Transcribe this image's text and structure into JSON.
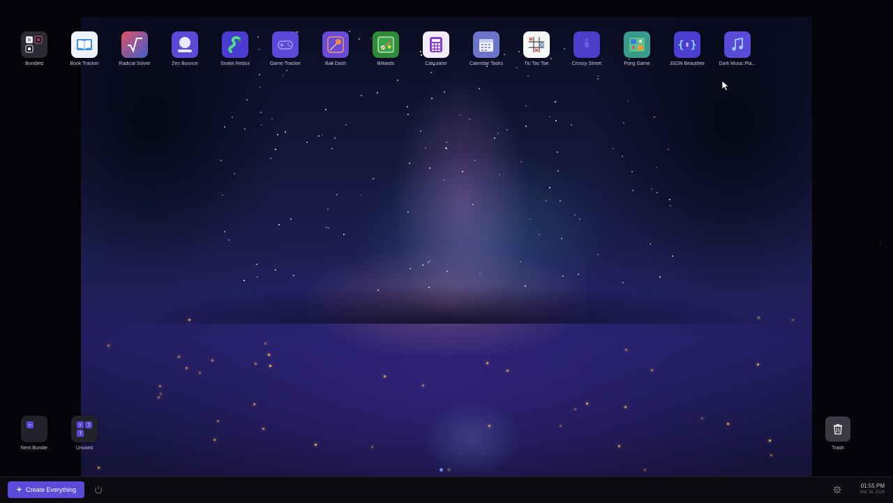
{
  "desktop": {
    "apps": [
      {
        "label": "Bundled",
        "icon": "bundle-folder-icon",
        "bg": "#2a2a34"
      },
      {
        "label": "Book Tracker",
        "icon": "book-icon",
        "bg": "#eef3fb"
      },
      {
        "label": "Radical Solver",
        "icon": "square-root-icon",
        "bg": "#d94a6a"
      },
      {
        "label": "Zen Bounce",
        "icon": "zen-ball-icon",
        "bg": "#5b4ad6"
      },
      {
        "label": "Snake Redux",
        "icon": "snake-icon",
        "bg": "#4a3bd1"
      },
      {
        "label": "Game Tracker",
        "icon": "gamepad-icon",
        "bg": "#5a48d8"
      },
      {
        "label": "Ball Dash",
        "icon": "ball-dash-icon",
        "bg": "#6a4ad6"
      },
      {
        "label": "Billiards",
        "icon": "billiards-icon",
        "bg": "#2f8a3a"
      },
      {
        "label": "Calculator",
        "icon": "calculator-icon",
        "bg": "#f1ecf8"
      },
      {
        "label": "Calendar Tasks",
        "icon": "calendar-icon",
        "bg": "#6c74c8"
      },
      {
        "label": "Tic Tac Toe",
        "icon": "tic-tac-toe-icon",
        "bg": "#f6f6f6"
      },
      {
        "label": "Crossy Street",
        "icon": "crossy-street-icon",
        "bg": "#4b3fc9"
      },
      {
        "label": "Pong Game",
        "icon": "pong-icon",
        "bg": "#3a9a8a"
      },
      {
        "label": "JSON Beautifier",
        "icon": "json-braces-icon",
        "bg": "#4a3ed0"
      },
      {
        "label": "Dark Music Pla...",
        "icon": "music-note-icon",
        "bg": "#5a4ad8"
      }
    ],
    "next_bundle": {
      "label": "Next Bundle",
      "icon": "next-bundle-icon"
    },
    "unused": {
      "label": "Unused",
      "icon": "unused-apps-folder-icon"
    },
    "trash": {
      "label": "Trash",
      "icon": "trash-icon"
    },
    "page_indicator": {
      "pages": 2,
      "current": 1
    }
  },
  "taskbar": {
    "create_label": "Create Everything",
    "create_icon": "sparkle-icon",
    "power_icon": "power-icon",
    "settings_icon": "gear-icon",
    "time": "01:55 PM",
    "date": "Mar 18, 2026"
  },
  "colors": {
    "accent": "#5a4cd8",
    "taskbar_bg": "#0b0b10",
    "trash_tile": "#3a3a42"
  }
}
